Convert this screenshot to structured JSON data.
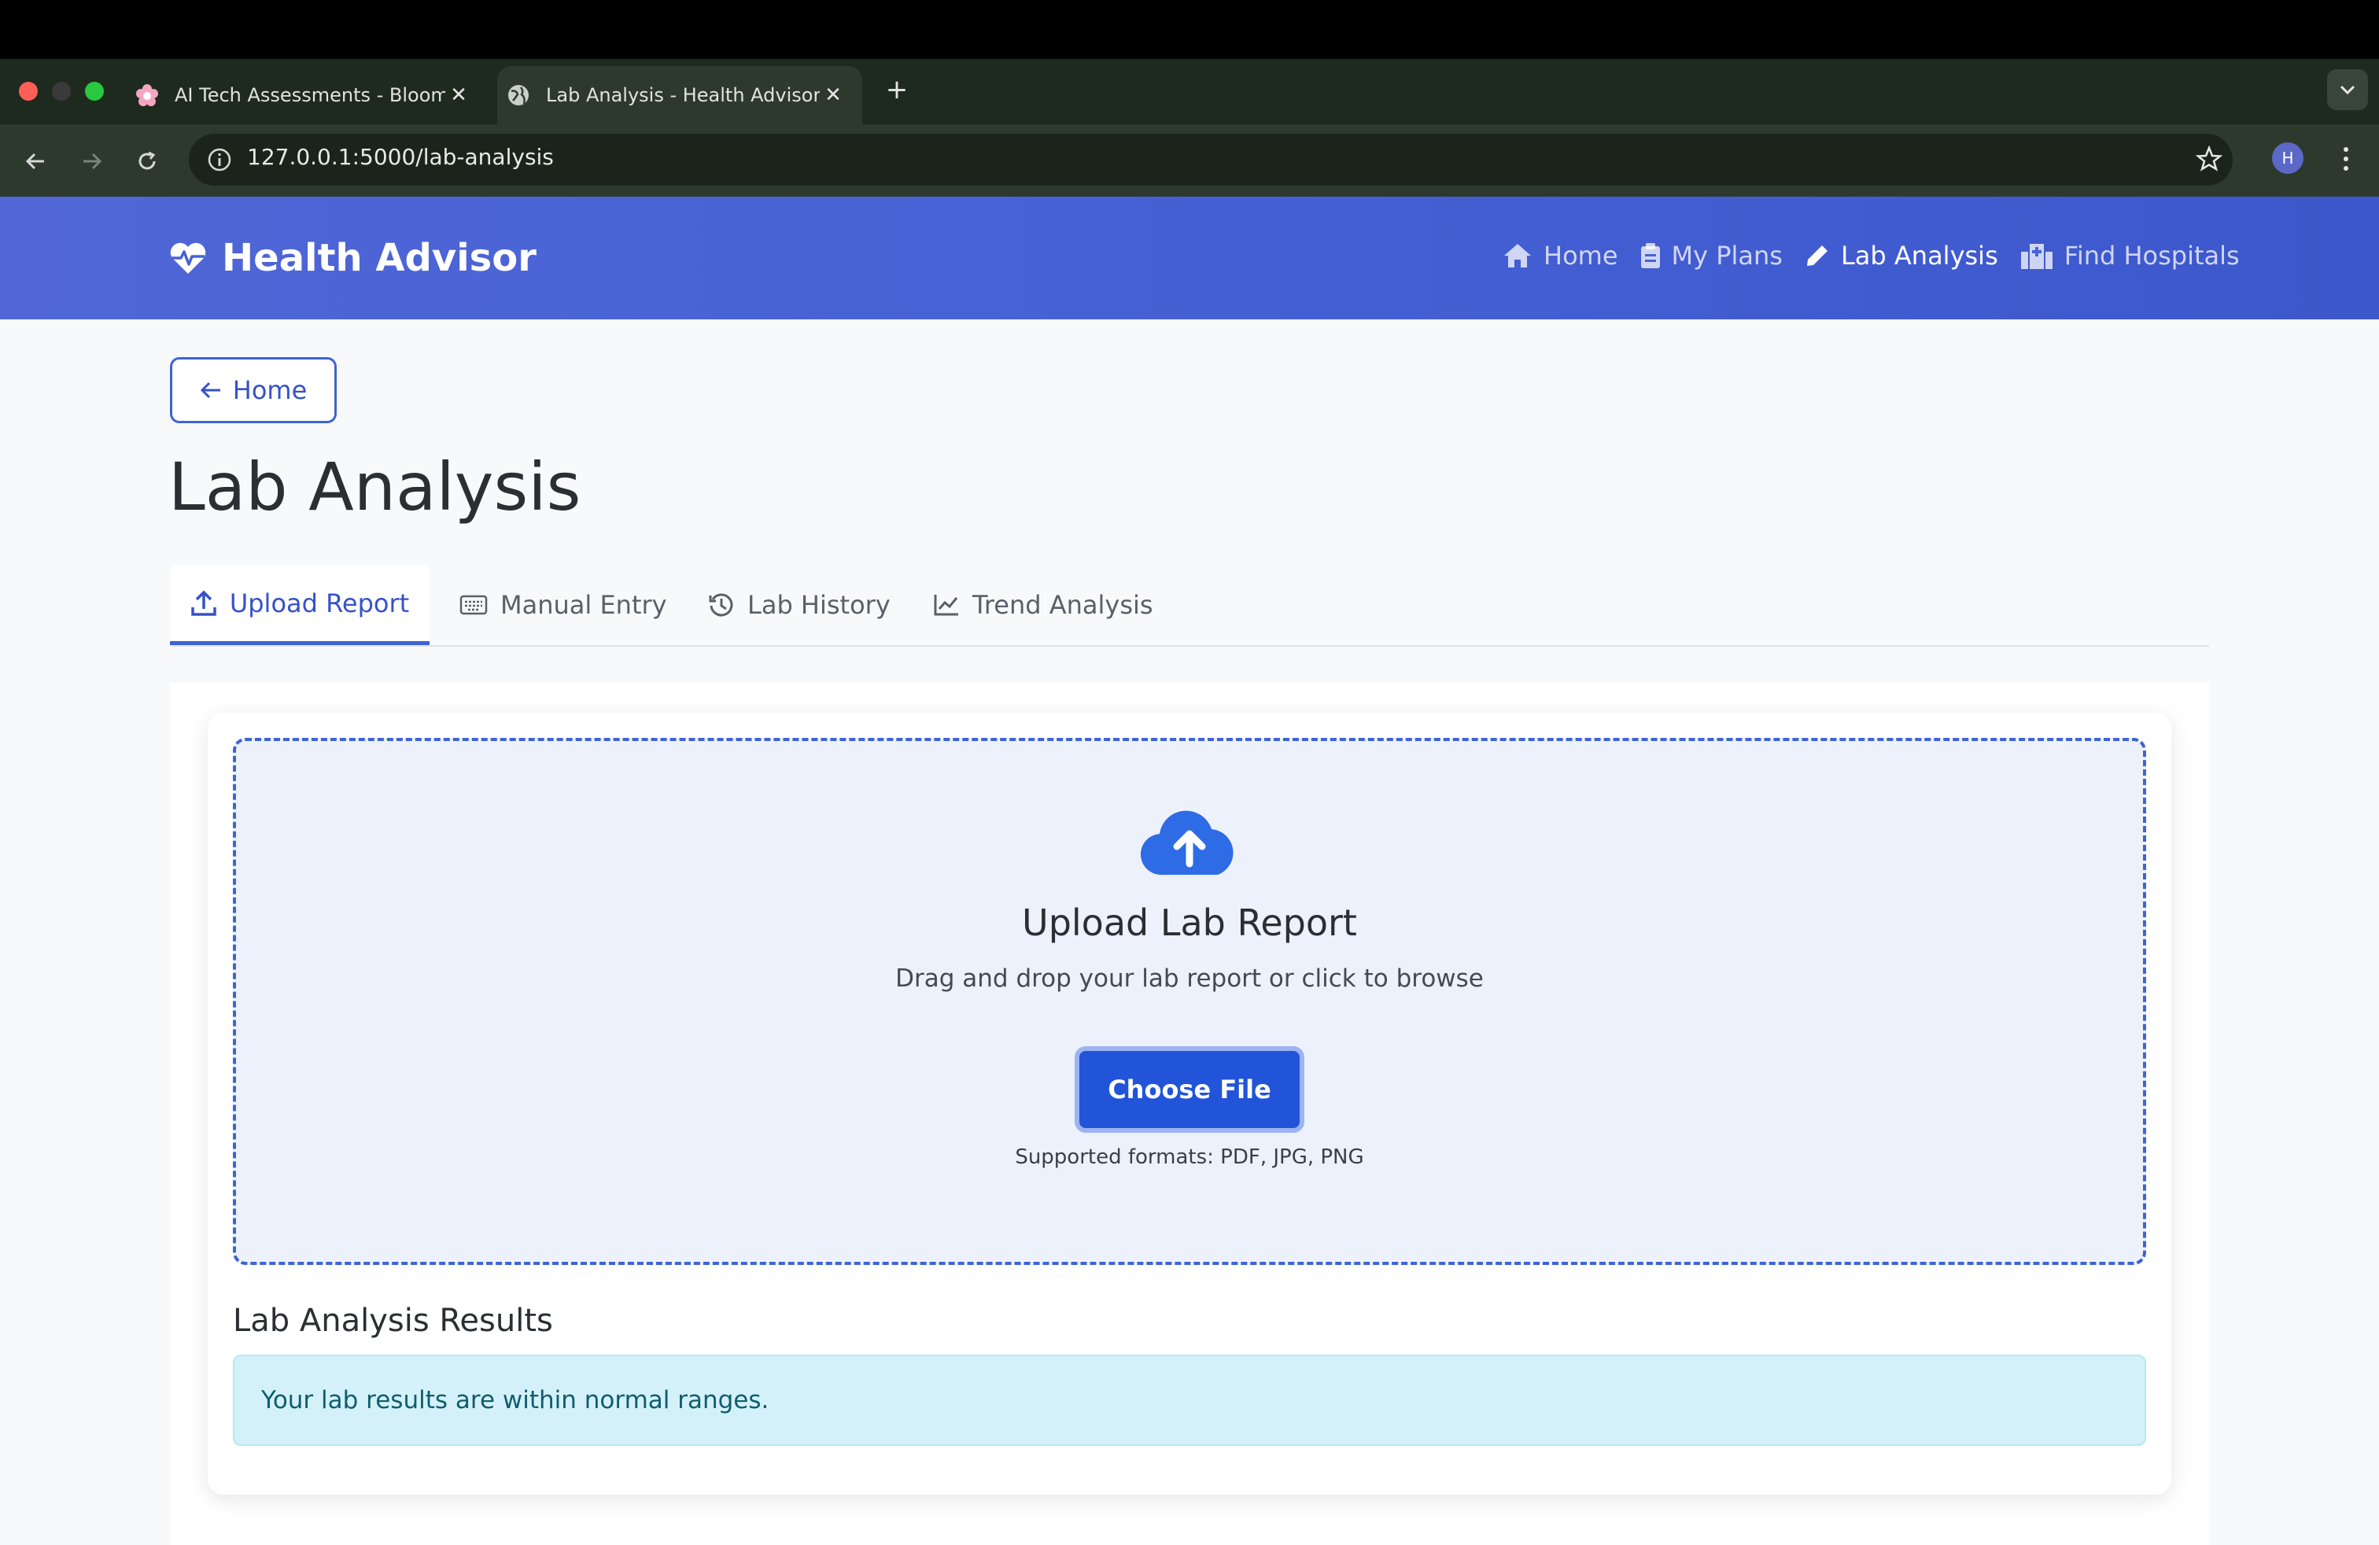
{
  "browser": {
    "tabs": [
      {
        "title": "AI Tech Assessments - Bloom",
        "active": false
      },
      {
        "title": "Lab Analysis - Health Advisor",
        "active": true
      }
    ],
    "new_tab": "+",
    "close_glyph": "✕",
    "url": "127.0.0.1:5000/lab-analysis",
    "profile_initial": "H",
    "traffic_colors": [
      "#ff5f57",
      "#3a3a3a",
      "#28c840"
    ]
  },
  "navbar": {
    "brand": "Health Advisor",
    "links": [
      {
        "label": "Home",
        "icon": "home-icon",
        "active": false
      },
      {
        "label": "My Plans",
        "icon": "clipboard-icon",
        "active": false
      },
      {
        "label": "Lab Analysis",
        "icon": "pencil-icon",
        "active": true
      },
      {
        "label": "Find Hospitals",
        "icon": "hospital-icon",
        "active": false
      }
    ]
  },
  "page": {
    "back_label": "Home",
    "title": "Lab Analysis",
    "tabs": [
      {
        "label": "Upload Report",
        "icon": "upload-icon",
        "active": true
      },
      {
        "label": "Manual Entry",
        "icon": "keyboard-icon",
        "active": false
      },
      {
        "label": "Lab History",
        "icon": "history-icon",
        "active": false
      },
      {
        "label": "Trend Analysis",
        "icon": "chart-line-icon",
        "active": false
      }
    ]
  },
  "upload": {
    "title": "Upload Lab Report",
    "subtitle": "Drag and drop your lab report or click to browse",
    "button": "Choose File",
    "formats": "Supported formats: PDF, JPG, PNG"
  },
  "results": {
    "title": "Lab Analysis Results",
    "message": "Your lab results are within normal ranges."
  },
  "colors": {
    "brand_blue": "#4762d6",
    "accent": "#2154d8",
    "alert_bg": "#d4f1f9",
    "alert_text": "#0f5d6e"
  }
}
